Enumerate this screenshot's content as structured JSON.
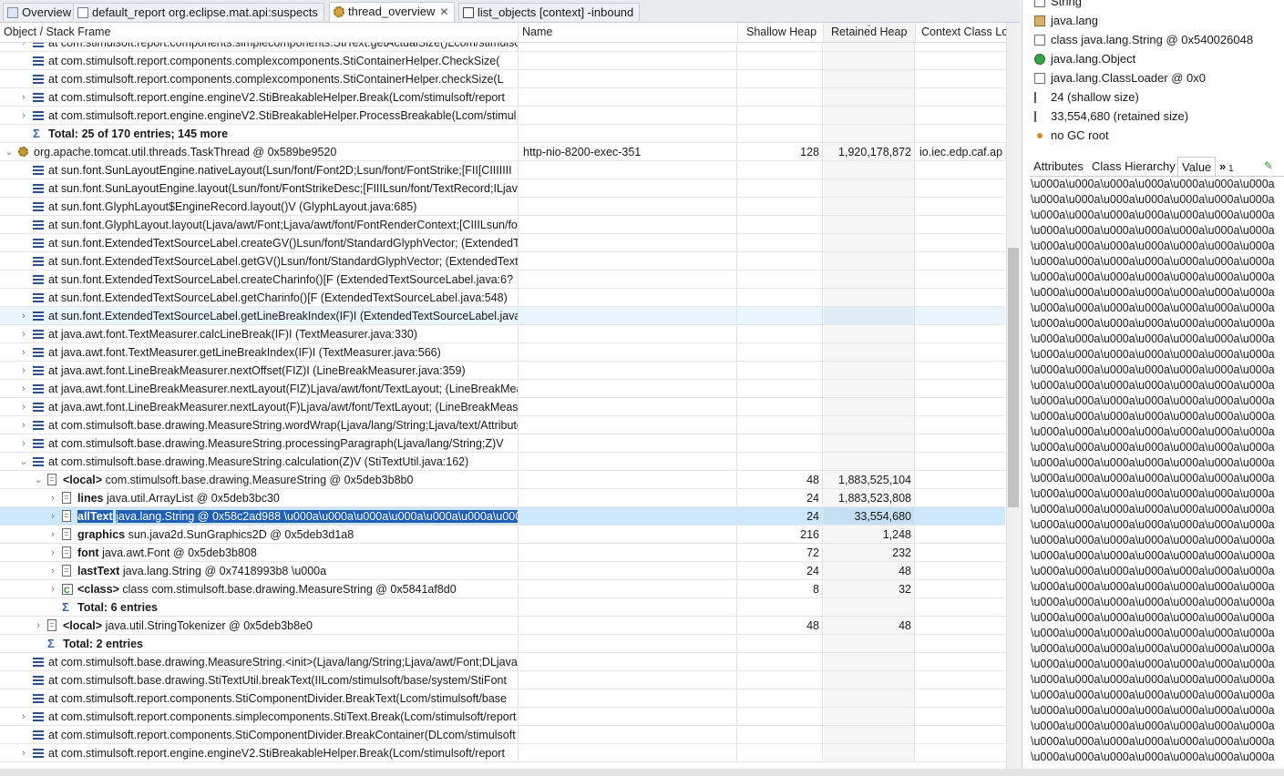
{
  "tabs": [
    {
      "label": "Overview",
      "icon": "info-icon",
      "active": false
    },
    {
      "label": "default_report  org.eclipse.mat.api:suspects",
      "icon": "report-icon",
      "active": false
    },
    {
      "label": "thread_overview",
      "icon": "thread-icon",
      "active": true
    },
    {
      "label": "list_objects  [context] -inbound",
      "icon": "list-icon",
      "active": false
    }
  ],
  "columns": [
    "Object / Stack Frame",
    "Name",
    "Shallow Heap",
    "Retained Heap",
    "Context Class Lo"
  ],
  "rows": [
    {
      "indent": 1,
      "twisty": "›",
      "icon": "frame",
      "text": "at com.stimulsoft.report.components.simplecomponents.StiText.getActualSize()Lcom/stimulsoft",
      "name": "",
      "shallow": "",
      "retained": "",
      "ctx": ""
    },
    {
      "indent": 1,
      "twisty": "",
      "icon": "frame",
      "text": "at com.stimulsoft.report.components.complexcomponents.StiContainerHelper.CheckSize(",
      "name": "",
      "shallow": "",
      "retained": "",
      "ctx": ""
    },
    {
      "indent": 1,
      "twisty": "",
      "icon": "frame",
      "text": "at com.stimulsoft.report.components.complexcomponents.StiContainerHelper.checkSize(L",
      "name": "",
      "shallow": "",
      "retained": "",
      "ctx": ""
    },
    {
      "indent": 1,
      "twisty": "›",
      "icon": "frame",
      "text": "at com.stimulsoft.report.engine.engineV2.StiBreakableHelper.Break(Lcom/stimulsoft/report",
      "name": "",
      "shallow": "",
      "retained": "",
      "ctx": ""
    },
    {
      "indent": 1,
      "twisty": "›",
      "icon": "frame",
      "text": "at com.stimulsoft.report.engine.engineV2.StiBreakableHelper.ProcessBreakable(Lcom/stimul",
      "name": "",
      "shallow": "",
      "retained": "",
      "ctx": ""
    },
    {
      "indent": 1,
      "twisty": "",
      "icon": "sigma",
      "text": "Total: 25 of 170 entries; 145 more",
      "bold": true,
      "name": "",
      "shallow": "",
      "retained": "",
      "ctx": ""
    },
    {
      "indent": 0,
      "twisty": "⌄",
      "icon": "gear",
      "text": "org.apache.tomcat.util.threads.TaskThread @ 0x589be9520",
      "name": "http-nio-8200-exec-351",
      "shallow": "128",
      "retained": "1,920,178,872",
      "ctx": "io.iec.edp.caf.ap"
    },
    {
      "indent": 1,
      "twisty": "",
      "icon": "frame",
      "text": "at sun.font.SunLayoutEngine.nativeLayout(Lsun/font/Font2D;Lsun/font/FontStrike;[FII[CIIIIIII",
      "name": "",
      "shallow": "",
      "retained": "",
      "ctx": ""
    },
    {
      "indent": 1,
      "twisty": "",
      "icon": "frame",
      "text": "at sun.font.SunLayoutEngine.layout(Lsun/font/FontStrikeDesc;[FIIILsun/font/TextRecord;ILjava",
      "name": "",
      "shallow": "",
      "retained": "",
      "ctx": ""
    },
    {
      "indent": 1,
      "twisty": "",
      "icon": "frame",
      "text": "at sun.font.GlyphLayout$EngineRecord.layout()V (GlyphLayout.java:685)",
      "name": "",
      "shallow": "",
      "retained": "",
      "ctx": ""
    },
    {
      "indent": 1,
      "twisty": "",
      "icon": "frame",
      "text": "at sun.font.GlyphLayout.layout(Ljava/awt/Font;Ljava/awt/font/FontRenderContext;[CIIILsun/font",
      "name": "",
      "shallow": "",
      "retained": "",
      "ctx": ""
    },
    {
      "indent": 1,
      "twisty": "",
      "icon": "frame",
      "text": "at sun.font.ExtendedTextSourceLabel.createGV()Lsun/font/StandardGlyphVector; (ExtendedTextSource",
      "name": "",
      "shallow": "",
      "retained": "",
      "ctx": ""
    },
    {
      "indent": 1,
      "twisty": "",
      "icon": "frame",
      "text": "at sun.font.ExtendedTextSourceLabel.getGV()Lsun/font/StandardGlyphVector; (ExtendedTextSourceLab",
      "name": "",
      "shallow": "",
      "retained": "",
      "ctx": ""
    },
    {
      "indent": 1,
      "twisty": "",
      "icon": "frame",
      "text": "at sun.font.ExtendedTextSourceLabel.createCharinfo()[F (ExtendedTextSourceLabel.java:6?",
      "name": "",
      "shallow": "",
      "retained": "",
      "ctx": ""
    },
    {
      "indent": 1,
      "twisty": "",
      "icon": "frame",
      "text": "at sun.font.ExtendedTextSourceLabel.getCharinfo()[F (ExtendedTextSourceLabel.java:548)",
      "name": "",
      "shallow": "",
      "retained": "",
      "ctx": ""
    },
    {
      "indent": 1,
      "twisty": "›",
      "icon": "frame",
      "text": "at sun.font.ExtendedTextSourceLabel.getLineBreakIndex(IF)I (ExtendedTextSourceLabel.java",
      "name": "",
      "shallow": "",
      "retained": "",
      "ctx": "",
      "hover": true
    },
    {
      "indent": 1,
      "twisty": "›",
      "icon": "frame",
      "text": "at java.awt.font.TextMeasurer.calcLineBreak(IF)I (TextMeasurer.java:330)",
      "name": "",
      "shallow": "",
      "retained": "",
      "ctx": ""
    },
    {
      "indent": 1,
      "twisty": "›",
      "icon": "frame",
      "text": "at java.awt.font.TextMeasurer.getLineBreakIndex(IF)I (TextMeasurer.java:566)",
      "name": "",
      "shallow": "",
      "retained": "",
      "ctx": ""
    },
    {
      "indent": 1,
      "twisty": "›",
      "icon": "frame",
      "text": "at java.awt.font.LineBreakMeasurer.nextOffset(FIZ)I (LineBreakMeasurer.java:359)",
      "name": "",
      "shallow": "",
      "retained": "",
      "ctx": ""
    },
    {
      "indent": 1,
      "twisty": "›",
      "icon": "frame",
      "text": "at java.awt.font.LineBreakMeasurer.nextLayout(FIZ)Ljava/awt/font/TextLayout; (LineBreakMeasurer",
      "name": "",
      "shallow": "",
      "retained": "",
      "ctx": ""
    },
    {
      "indent": 1,
      "twisty": "›",
      "icon": "frame",
      "text": "at java.awt.font.LineBreakMeasurer.nextLayout(F)Ljava/awt/font/TextLayout; (LineBreakMeasurer",
      "name": "",
      "shallow": "",
      "retained": "",
      "ctx": ""
    },
    {
      "indent": 1,
      "twisty": "›",
      "icon": "frame",
      "text": "at com.stimulsoft.base.drawing.MeasureString.wordWrap(Ljava/lang/String;Ljava/text/AttributedStr",
      "name": "",
      "shallow": "",
      "retained": "",
      "ctx": ""
    },
    {
      "indent": 1,
      "twisty": "›",
      "icon": "frame",
      "text": "at com.stimulsoft.base.drawing.MeasureString.processingParagraph(Ljava/lang/String;Z)V",
      "name": "",
      "shallow": "",
      "retained": "",
      "ctx": ""
    },
    {
      "indent": 1,
      "twisty": "⌄",
      "icon": "frame",
      "text": "at com.stimulsoft.base.drawing.MeasureString.calculation(Z)V (StiTextUtil.java:162)",
      "name": "",
      "shallow": "",
      "retained": "",
      "ctx": ""
    },
    {
      "indent": 2,
      "twisty": "⌄",
      "icon": "doc",
      "text": "com.stimulsoft.base.drawing.MeasureString @ 0x5deb3b8b0",
      "prefix": "<local>",
      "name": "",
      "shallow": "48",
      "retained": "1,883,525,104",
      "ctx": ""
    },
    {
      "indent": 3,
      "twisty": "›",
      "icon": "doc",
      "text": "java.util.ArrayList @ 0x5deb3bc30",
      "prefix": "lines",
      "name": "",
      "shallow": "24",
      "retained": "1,883,523,808",
      "ctx": ""
    },
    {
      "indent": 3,
      "twisty": "›",
      "icon": "doc",
      "text": "java.lang.String @ 0x58c2ad988  \\u000a\\u000a\\u000a\\u000a\\u000a\\u000a\\u000a",
      "prefix": "allText",
      "name": "",
      "shallow": "24",
      "retained": "33,554,680",
      "ctx": "",
      "selected": true
    },
    {
      "indent": 3,
      "twisty": "›",
      "icon": "doc",
      "text": "sun.java2d.SunGraphics2D @ 0x5deb3d1a8",
      "prefix": "graphics",
      "name": "",
      "shallow": "216",
      "retained": "1,248",
      "ctx": ""
    },
    {
      "indent": 3,
      "twisty": "›",
      "icon": "doc",
      "text": "java.awt.Font @ 0x5deb3b808",
      "prefix": "font",
      "name": "",
      "shallow": "72",
      "retained": "232",
      "ctx": ""
    },
    {
      "indent": 3,
      "twisty": "›",
      "icon": "doc",
      "text": "java.lang.String @ 0x7418993b8  \\u000a",
      "prefix": "lastText",
      "name": "",
      "shallow": "24",
      "retained": "48",
      "ctx": ""
    },
    {
      "indent": 3,
      "twisty": "›",
      "icon": "cls",
      "text": "class com.stimulsoft.base.drawing.MeasureString @ 0x5841af8d0",
      "prefix": "<class>",
      "name": "",
      "shallow": "8",
      "retained": "32",
      "ctx": ""
    },
    {
      "indent": 3,
      "twisty": "",
      "icon": "sigma",
      "text": "Total: 6 entries",
      "bold": true,
      "name": "",
      "shallow": "",
      "retained": "",
      "ctx": ""
    },
    {
      "indent": 2,
      "twisty": "›",
      "icon": "doc",
      "text": "java.util.StringTokenizer @ 0x5deb3b8e0",
      "prefix": "<local>",
      "name": "",
      "shallow": "48",
      "retained": "48",
      "ctx": ""
    },
    {
      "indent": 2,
      "twisty": "",
      "icon": "sigma",
      "text": "Total: 2 entries",
      "bold": true,
      "name": "",
      "shallow": "",
      "retained": "",
      "ctx": ""
    },
    {
      "indent": 1,
      "twisty": "",
      "icon": "frame",
      "text": "at com.stimulsoft.base.drawing.MeasureString.<init>(Ljava/lang/String;Ljava/awt/Font;DLjava",
      "name": "",
      "shallow": "",
      "retained": "",
      "ctx": ""
    },
    {
      "indent": 1,
      "twisty": "",
      "icon": "frame",
      "text": "at com.stimulsoft.base.drawing.StiTextUtil.breakText(IILcom/stimulsoft/base/system/StiFont",
      "name": "",
      "shallow": "",
      "retained": "",
      "ctx": ""
    },
    {
      "indent": 1,
      "twisty": "",
      "icon": "frame",
      "text": "at com.stimulsoft.report.components.StiComponentDivider.BreakText(Lcom/stimulsoft/base",
      "name": "",
      "shallow": "",
      "retained": "",
      "ctx": ""
    },
    {
      "indent": 1,
      "twisty": "›",
      "icon": "frame",
      "text": "at com.stimulsoft.report.components.simplecomponents.StiText.Break(Lcom/stimulsoft/report",
      "name": "",
      "shallow": "",
      "retained": "",
      "ctx": ""
    },
    {
      "indent": 1,
      "twisty": "",
      "icon": "frame",
      "text": "at com.stimulsoft.report.components.StiComponentDivider.BreakContainer(DLcom/stimulsoft",
      "name": "",
      "shallow": "",
      "retained": "",
      "ctx": ""
    },
    {
      "indent": 1,
      "twisty": "›",
      "icon": "frame",
      "text": "at com.stimulsoft.report.engine.engineV2.StiBreakableHelper.Break(Lcom/stimulsoft/report",
      "name": "",
      "shallow": "",
      "retained": "",
      "ctx": ""
    }
  ],
  "inspector": {
    "items": [
      {
        "icon": "class-icon",
        "label": "String"
      },
      {
        "icon": "package-icon",
        "label": "java.lang"
      },
      {
        "icon": "class-icon",
        "label": "class java.lang.String @ 0x540026048"
      },
      {
        "icon": "object-icon",
        "label": "java.lang.Object"
      },
      {
        "icon": "class-icon",
        "label": "java.lang.ClassLoader @ 0x0"
      },
      {
        "icon": "size-icon",
        "label": "24 (shallow size)"
      },
      {
        "icon": "size-icon",
        "label": "33,554,680 (retained size)"
      },
      {
        "icon": "gc-root-icon",
        "label": "no GC root"
      }
    ],
    "tabs": [
      "Attributes",
      "Class Hierarchy",
      "Value",
      "»",
      "1"
    ],
    "active_tab": "Value",
    "value_line": "\\u000a\\u000a\\u000a\\u000a\\u000a\\u000a\\u000a",
    "value_line_count": 38
  }
}
